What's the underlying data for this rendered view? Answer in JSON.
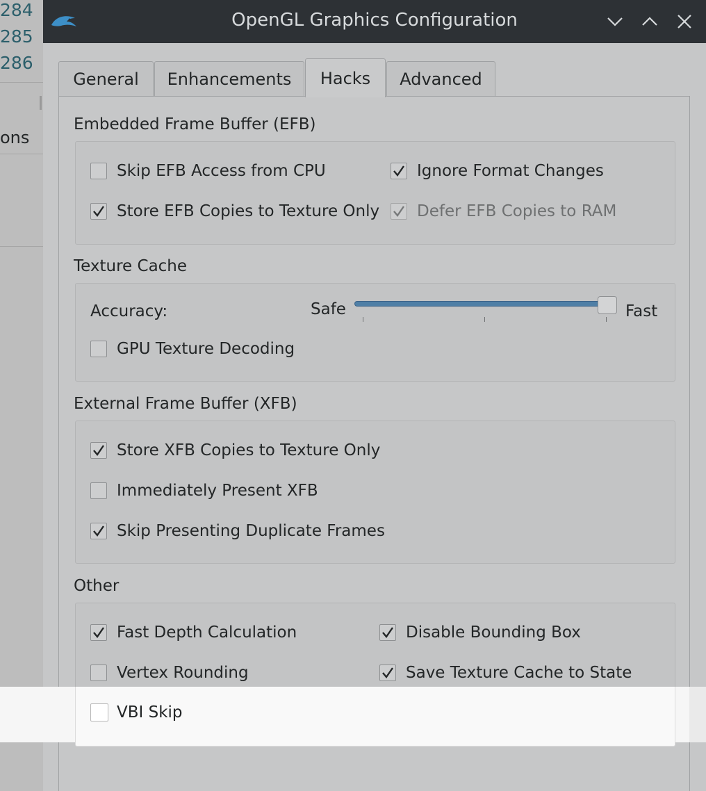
{
  "background": {
    "line_numbers": [
      "284",
      "285",
      "286"
    ],
    "partial_text": "ons"
  },
  "window": {
    "title": "OpenGL Graphics Configuration",
    "icon": "dolphin-logo-icon",
    "controls": [
      "minimize-icon",
      "maximize-icon",
      "close-icon"
    ]
  },
  "tabs": [
    {
      "label": "General",
      "active": false
    },
    {
      "label": "Enhancements",
      "active": false
    },
    {
      "label": "Hacks",
      "active": true
    },
    {
      "label": "Advanced",
      "active": false
    }
  ],
  "efb": {
    "title": "Embedded Frame Buffer (EFB)",
    "skip_access": {
      "label": "Skip EFB Access from CPU",
      "checked": false
    },
    "ignore_format": {
      "label": "Ignore Format Changes",
      "checked": true
    },
    "store_copies": {
      "label": "Store EFB Copies to Texture Only",
      "checked": true
    },
    "defer_copies": {
      "label": "Defer EFB Copies to RAM",
      "checked": true,
      "disabled": true
    }
  },
  "texture_cache": {
    "title": "Texture Cache",
    "accuracy_label": "Accuracy:",
    "safe_label": "Safe",
    "fast_label": "Fast",
    "accuracy_level": 1.0,
    "gpu_decoding": {
      "label": "GPU Texture Decoding",
      "checked": false
    }
  },
  "xfb": {
    "title": "External Frame Buffer (XFB)",
    "store_copies": {
      "label": "Store XFB Copies to Texture Only",
      "checked": true
    },
    "immediately_present": {
      "label": "Immediately Present XFB",
      "checked": false
    },
    "skip_duplicates": {
      "label": "Skip Presenting Duplicate Frames",
      "checked": true
    }
  },
  "other": {
    "title": "Other",
    "fast_depth": {
      "label": "Fast Depth Calculation",
      "checked": true
    },
    "disable_bbox": {
      "label": "Disable Bounding Box",
      "checked": true
    },
    "vertex_rounding": {
      "label": "Vertex Rounding",
      "checked": false
    },
    "save_texture_cache": {
      "label": "Save Texture Cache to State",
      "checked": true
    },
    "vbi_skip": {
      "label": "VBI Skip",
      "checked": false
    }
  },
  "colors": {
    "titlebar": "#2d3135",
    "accent": "#4f7fa6",
    "dialog_bg": "#c6c7c8"
  }
}
